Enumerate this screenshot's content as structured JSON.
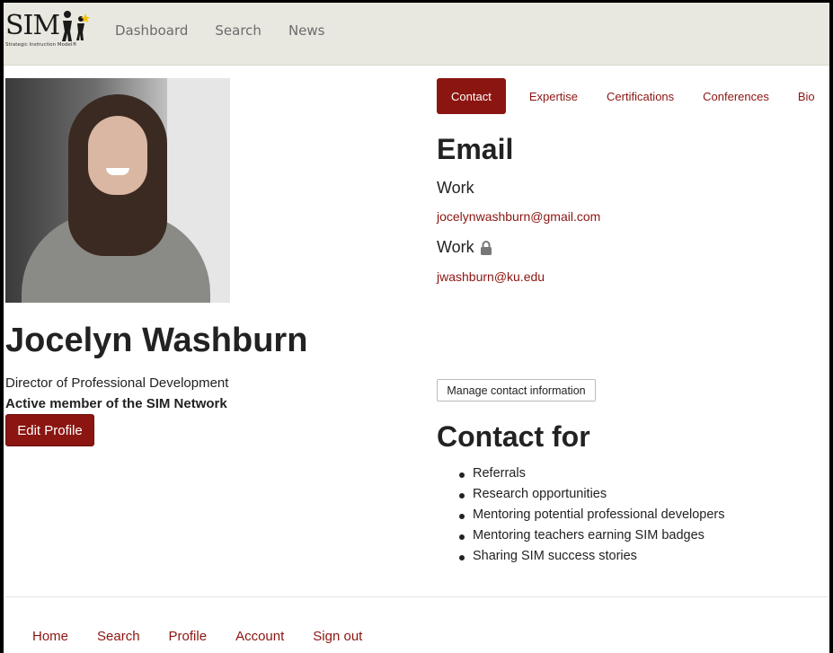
{
  "logo": {
    "text": "SIM",
    "tagline": "Strategic Instruction Model®"
  },
  "topnav": {
    "dashboard": "Dashboard",
    "search": "Search",
    "news": "News"
  },
  "profile": {
    "name": "Jocelyn Washburn",
    "role": "Director of Professional Development",
    "membership": "Active member of the SIM Network",
    "edit_label": "Edit Profile"
  },
  "tabs": {
    "contact": "Contact",
    "expertise": "Expertise",
    "certifications": "Certifications",
    "conferences": "Conferences",
    "bio": "Bio"
  },
  "email": {
    "heading": "Email",
    "work_label": "Work",
    "work_email": "jocelynwashburn@gmail.com",
    "private_label": "Work",
    "private_email": "jwashburn@ku.edu"
  },
  "manage_label": "Manage contact information",
  "contact_for": {
    "heading": "Contact for",
    "items": [
      "Referrals",
      "Research opportunities",
      "Mentoring potential professional developers",
      "Mentoring teachers earning SIM badges",
      "Sharing SIM success stories"
    ]
  },
  "footer": {
    "home": "Home",
    "search": "Search",
    "profile": "Profile",
    "account": "Account",
    "signout": "Sign out"
  },
  "colors": {
    "accent": "#8b1510",
    "topbar": "#e9e8e0"
  }
}
